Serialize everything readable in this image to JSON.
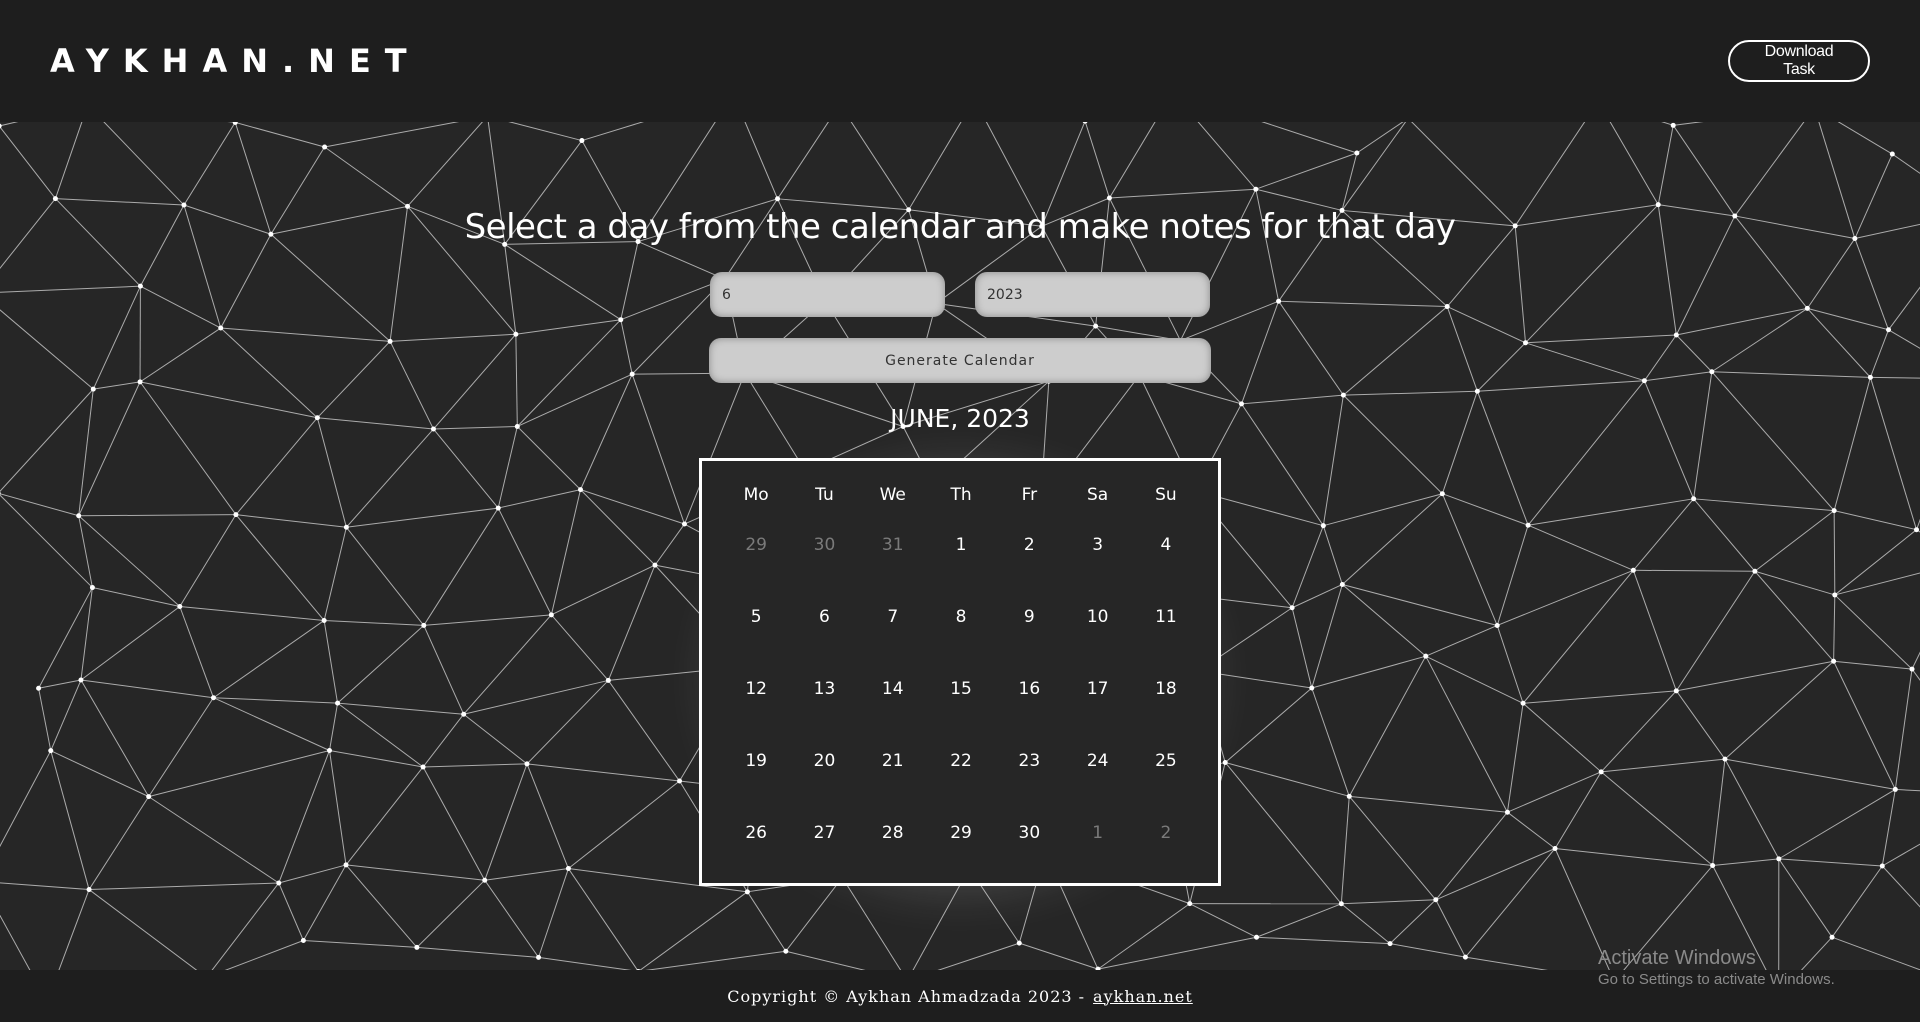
{
  "header": {
    "logo": "AYKHAN.NET",
    "download_label": "Download Task"
  },
  "main": {
    "headline": "Select a day from the calendar and make notes for that day",
    "month_input_value": "6",
    "year_input_value": "2023",
    "generate_label": "Generate Calendar",
    "month_title": "JUNE, 2023"
  },
  "calendar": {
    "weekdays": [
      "Mo",
      "Tu",
      "We",
      "Th",
      "Fr",
      "Sa",
      "Su"
    ],
    "weeks": [
      [
        {
          "d": "29",
          "m": true
        },
        {
          "d": "30",
          "m": true
        },
        {
          "d": "31",
          "m": true
        },
        {
          "d": "1"
        },
        {
          "d": "2"
        },
        {
          "d": "3"
        },
        {
          "d": "4"
        }
      ],
      [
        {
          "d": "5"
        },
        {
          "d": "6"
        },
        {
          "d": "7"
        },
        {
          "d": "8"
        },
        {
          "d": "9"
        },
        {
          "d": "10"
        },
        {
          "d": "11"
        }
      ],
      [
        {
          "d": "12"
        },
        {
          "d": "13"
        },
        {
          "d": "14"
        },
        {
          "d": "15"
        },
        {
          "d": "16"
        },
        {
          "d": "17"
        },
        {
          "d": "18"
        }
      ],
      [
        {
          "d": "19"
        },
        {
          "d": "20"
        },
        {
          "d": "21"
        },
        {
          "d": "22"
        },
        {
          "d": "23"
        },
        {
          "d": "24"
        },
        {
          "d": "25"
        }
      ],
      [
        {
          "d": "26"
        },
        {
          "d": "27"
        },
        {
          "d": "28"
        },
        {
          "d": "29"
        },
        {
          "d": "30"
        },
        {
          "d": "1",
          "m": true
        },
        {
          "d": "2",
          "m": true
        }
      ]
    ]
  },
  "footer": {
    "copyright": "Copyright © Aykhan Ahmadzada 2023 -",
    "link": "aykhan.net"
  },
  "watermark": {
    "title": "Activate Windows",
    "subtitle": "Go to Settings to activate Windows."
  }
}
